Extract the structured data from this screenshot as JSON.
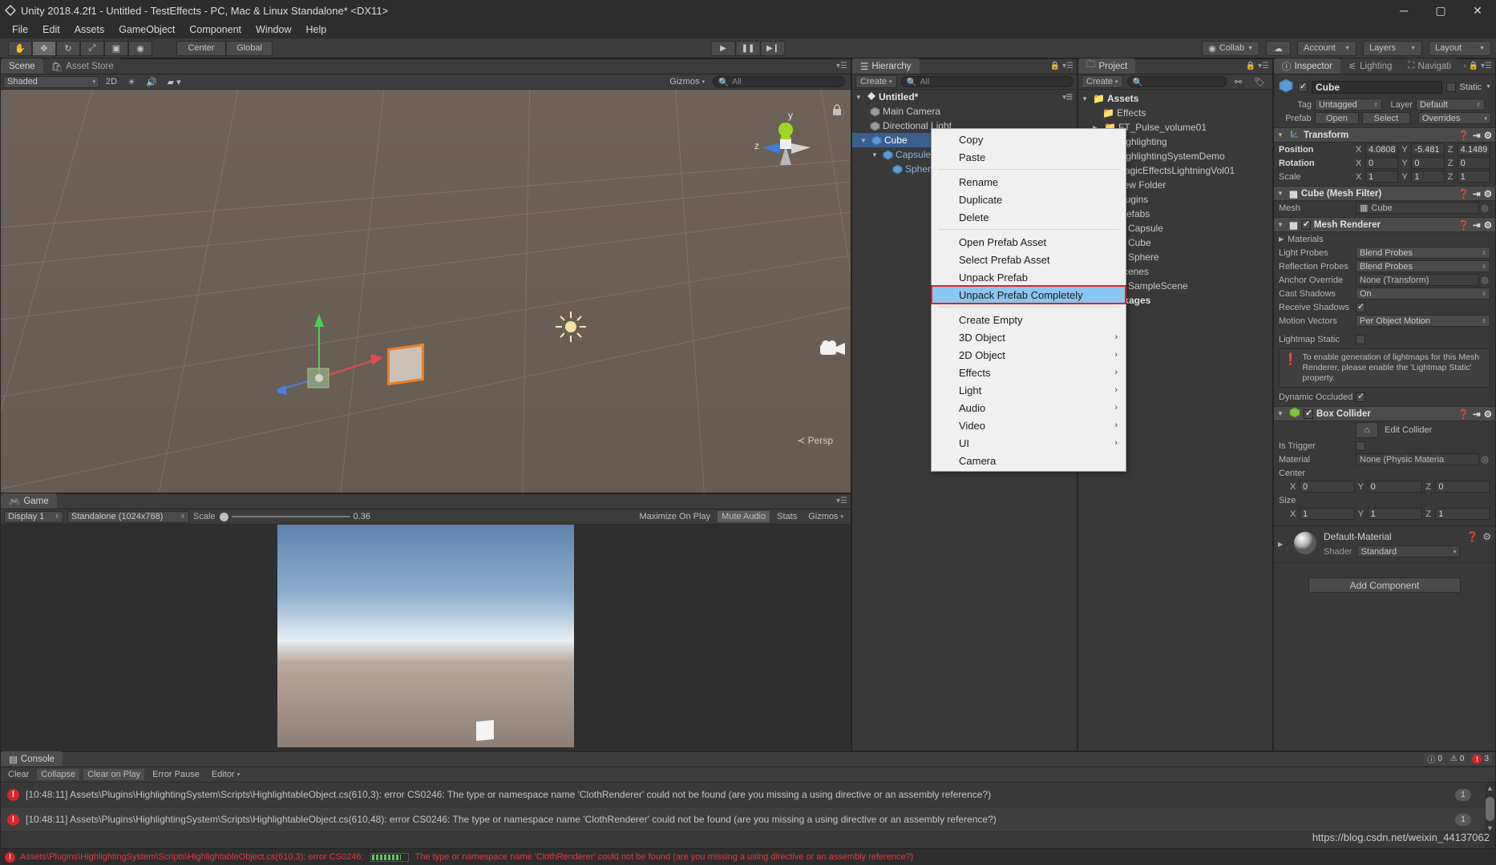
{
  "window": {
    "title": "Unity 2018.4.2f1 - Untitled - TestEffects - PC, Mac & Linux Standalone* <DX11>",
    "minimize": "─",
    "maximize": "▢",
    "close": "✕"
  },
  "menubar": {
    "items": [
      "File",
      "Edit",
      "Assets",
      "GameObject",
      "Component",
      "Window",
      "Help"
    ]
  },
  "toolbar": {
    "tools": [
      {
        "name": "hand-tool",
        "glyph": "✋"
      },
      {
        "name": "move-tool",
        "glyph": "✥"
      },
      {
        "name": "rotate-tool",
        "glyph": "↻"
      },
      {
        "name": "scale-tool",
        "glyph": "⤢"
      },
      {
        "name": "rect-tool",
        "glyph": "▣"
      },
      {
        "name": "transform-tool",
        "glyph": "◉"
      }
    ],
    "pivot": "Center",
    "handle": "Global",
    "play": "▶",
    "pause": "❚❚",
    "step": "▶❙",
    "collab": "Collab",
    "cloud": "☁",
    "account": "Account",
    "layers": "Layers",
    "layout": "Layout"
  },
  "scene": {
    "tabs": [
      {
        "label": "Scene",
        "active": true
      },
      {
        "label": "Asset Store",
        "active": false
      }
    ],
    "shading": "Shaded",
    "mode_2d": "2D",
    "gizmos_label": "Gizmos",
    "gizmos_search": "All",
    "persp_label": "Persp",
    "axis_y": "y",
    "axis_z": "z"
  },
  "game": {
    "tab": "Game",
    "display": "Display 1",
    "aspect": "Standalone (1024x768)",
    "scale_label": "Scale",
    "scale_value": "0.36",
    "maximize_on_play": "Maximize On Play",
    "mute_audio": "Mute Audio",
    "stats": "Stats",
    "gizmos": "Gizmos"
  },
  "hierarchy": {
    "tab": "Hierarchy",
    "create": "Create",
    "search_placeholder": "All",
    "scene_name": "Untitled*",
    "items": [
      {
        "label": "Main Camera",
        "indent": 1,
        "selected": false,
        "prefab": false,
        "expandable": false
      },
      {
        "label": "Directional Light",
        "indent": 1,
        "selected": false,
        "prefab": false,
        "expandable": false
      },
      {
        "label": "Cube",
        "indent": 1,
        "selected": true,
        "prefab": false,
        "expandable": true
      },
      {
        "label": "Capsule",
        "indent": 2,
        "selected": false,
        "prefab": true,
        "expandable": true
      },
      {
        "label": "Sphere",
        "indent": 3,
        "selected": false,
        "prefab": true,
        "expandable": false
      }
    ]
  },
  "project": {
    "tab": "Project",
    "create": "Create",
    "search_placeholder": "",
    "items": [
      {
        "label": "Assets",
        "indent": 0,
        "expandable": true,
        "expanded": true,
        "bold": true
      },
      {
        "label": "Effects",
        "indent": 1,
        "expandable": false
      },
      {
        "label": "FT_Pulse_volume01",
        "indent": 1,
        "expandable": true
      },
      {
        "label": "Highlighting",
        "indent": 1,
        "expandable": false
      },
      {
        "label": "HighlightingSystemDemo",
        "indent": 1,
        "expandable": false
      },
      {
        "label": "MagicEffectsLightningVol01",
        "indent": 1,
        "expandable": false
      },
      {
        "label": "New Folder",
        "indent": 1,
        "expandable": false
      },
      {
        "label": "Plugins",
        "indent": 1,
        "expandable": false
      },
      {
        "label": "Prefabs",
        "indent": 1,
        "expandable": false
      },
      {
        "label": "Capsule",
        "indent": 2,
        "expandable": false
      },
      {
        "label": "Cube",
        "indent": 2,
        "expandable": false
      },
      {
        "label": "Sphere",
        "indent": 2,
        "expandable": false
      },
      {
        "label": "Scenes",
        "indent": 1,
        "expandable": false
      },
      {
        "label": "SampleScene",
        "indent": 2,
        "expandable": false
      },
      {
        "label": "Packages",
        "indent": 0,
        "expandable": false,
        "bold": true
      }
    ]
  },
  "inspector": {
    "tabs": [
      {
        "label": "Inspector",
        "active": true
      },
      {
        "label": "Lighting",
        "active": false
      },
      {
        "label": "Navigati",
        "active": false
      }
    ],
    "object_name": "Cube",
    "object_enabled": true,
    "static_label": "Static",
    "tag_label": "Tag",
    "tag_value": "Untagged",
    "layer_label": "Layer",
    "layer_value": "Default",
    "prefab_label": "Prefab",
    "prefab_open": "Open",
    "prefab_select": "Select",
    "prefab_overrides": "Overrides",
    "transform": {
      "title": "Transform",
      "position_label": "Position",
      "position": {
        "x": "4.0808",
        "y": "-5.481",
        "z": "4.1489"
      },
      "rotation_label": "Rotation",
      "rotation": {
        "x": "0",
        "y": "0",
        "z": "0"
      },
      "scale_label": "Scale",
      "scale": {
        "x": "1",
        "y": "1",
        "z": "1"
      }
    },
    "mesh_filter": {
      "title": "Cube (Mesh Filter)",
      "mesh_label": "Mesh",
      "mesh_value": "Cube"
    },
    "mesh_renderer": {
      "title": "Mesh Renderer",
      "enabled": true,
      "materials_label": "Materials",
      "light_probes_label": "Light Probes",
      "light_probes_value": "Blend Probes",
      "reflection_probes_label": "Reflection Probes",
      "reflection_probes_value": "Blend Probes",
      "anchor_override_label": "Anchor Override",
      "anchor_override_value": "None (Transform)",
      "cast_shadows_label": "Cast Shadows",
      "cast_shadows_value": "On",
      "receive_shadows_label": "Receive Shadows",
      "receive_shadows_value": true,
      "motion_vectors_label": "Motion Vectors",
      "motion_vectors_value": "Per Object Motion",
      "lightmap_static_label": "Lightmap Static",
      "lightmap_static_value": false,
      "help_text": "To enable generation of lightmaps for this Mesh Renderer, please enable the 'Lightmap Static' property.",
      "dynamic_occluded_label": "Dynamic Occluded",
      "dynamic_occluded_value": true
    },
    "box_collider": {
      "title": "Box Collider",
      "enabled": true,
      "edit_collider": "Edit Collider",
      "is_trigger_label": "Is Trigger",
      "is_trigger_value": false,
      "material_label": "Material",
      "material_value": "None (Physic Materia",
      "center_label": "Center",
      "center": {
        "x": "0",
        "y": "0",
        "z": "0"
      },
      "size_label": "Size",
      "size": {
        "x": "1",
        "y": "1",
        "z": "1"
      }
    },
    "material": {
      "title": "Default-Material",
      "shader_label": "Shader",
      "shader_value": "Standard"
    },
    "add_component": "Add Component"
  },
  "context_menu": {
    "items": [
      {
        "label": "Copy",
        "submenu": false,
        "highlighted": false,
        "separator_after": false
      },
      {
        "label": "Paste",
        "submenu": false,
        "highlighted": false,
        "separator_after": true
      },
      {
        "label": "Rename",
        "submenu": false,
        "highlighted": false,
        "separator_after": false
      },
      {
        "label": "Duplicate",
        "submenu": false,
        "highlighted": false,
        "separator_after": false
      },
      {
        "label": "Delete",
        "submenu": false,
        "highlighted": false,
        "separator_after": true
      },
      {
        "label": "Open Prefab Asset",
        "submenu": false,
        "highlighted": false,
        "separator_after": false
      },
      {
        "label": "Select Prefab Asset",
        "submenu": false,
        "highlighted": false,
        "separator_after": false
      },
      {
        "label": "Unpack Prefab",
        "submenu": false,
        "highlighted": false,
        "separator_after": false
      },
      {
        "label": "Unpack Prefab Completely",
        "submenu": false,
        "highlighted": true,
        "separator_after": true
      },
      {
        "label": "Create Empty",
        "submenu": false,
        "highlighted": false,
        "separator_after": false
      },
      {
        "label": "3D Object",
        "submenu": true,
        "highlighted": false,
        "separator_after": false
      },
      {
        "label": "2D Object",
        "submenu": true,
        "highlighted": false,
        "separator_after": false
      },
      {
        "label": "Effects",
        "submenu": true,
        "highlighted": false,
        "separator_after": false
      },
      {
        "label": "Light",
        "submenu": true,
        "highlighted": false,
        "separator_after": false
      },
      {
        "label": "Audio",
        "submenu": true,
        "highlighted": false,
        "separator_after": false
      },
      {
        "label": "Video",
        "submenu": true,
        "highlighted": false,
        "separator_after": false
      },
      {
        "label": "UI",
        "submenu": true,
        "highlighted": false,
        "separator_after": false
      },
      {
        "label": "Camera",
        "submenu": false,
        "highlighted": false,
        "separator_after": false
      }
    ]
  },
  "console": {
    "tab": "Console",
    "clear": "Clear",
    "collapse": "Collapse",
    "clear_on_play": "Clear on Play",
    "error_pause": "Error Pause",
    "editor": "Editor",
    "counts": {
      "info": "0",
      "warning": "0",
      "error": "3"
    },
    "messages": [
      {
        "text": "[10:48:11] Assets\\Plugins\\HighlightingSystem\\Scripts\\HighlightableObject.cs(610,3): error CS0246: The type or namespace name 'ClothRenderer' could not be found (are you missing a using directive or an assembly reference?)",
        "count": "1"
      },
      {
        "text": "[10:48:11] Assets\\Plugins\\HighlightingSystem\\Scripts\\HighlightableObject.cs(610,48): error CS0246: The type or namespace name 'ClothRenderer' could not be found (are you missing a using directive or an assembly reference?)",
        "count": "1"
      }
    ]
  },
  "statusbar": {
    "text_before": "Assets\\Plugins\\HighlightingSystem\\Scripts\\HighlightableObject.cs(610,3): error CS0246:",
    "text_after": "The type or namespace name 'ClothRenderer' could not be found (are you missing a using directive or an assembly reference?)"
  },
  "watermark": "https://blog.csdn.net/weixin_44137062",
  "colors": {
    "selection_blue": "#3a5f8f",
    "prefab_blue": "#8ab4e8",
    "error_red": "#d62626",
    "menu_highlight": "#8ac6f0",
    "menu_outline": "#ee1c1c"
  }
}
